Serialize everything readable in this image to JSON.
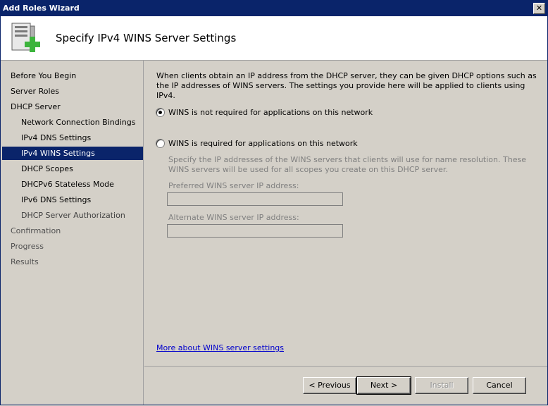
{
  "window": {
    "title": "Add Roles Wizard"
  },
  "header": {
    "page_title": "Specify IPv4 WINS Server Settings"
  },
  "sidebar": {
    "items": [
      {
        "label": "Before You Begin"
      },
      {
        "label": "Server Roles"
      },
      {
        "label": "DHCP Server"
      },
      {
        "label": "Network Connection Bindings"
      },
      {
        "label": "IPv4 DNS Settings"
      },
      {
        "label": "IPv4 WINS Settings"
      },
      {
        "label": "DHCP Scopes"
      },
      {
        "label": "DHCPv6 Stateless Mode"
      },
      {
        "label": "IPv6 DNS Settings"
      },
      {
        "label": "DHCP Server Authorization"
      },
      {
        "label": "Confirmation"
      },
      {
        "label": "Progress"
      },
      {
        "label": "Results"
      }
    ]
  },
  "main": {
    "intro": "When clients obtain an IP address from the DHCP server, they can be given DHCP options such as the IP addresses of WINS servers. The settings you provide here will be applied to clients using IPv4.",
    "option_not_required": "WINS is not required for applications on this network",
    "option_required": "WINS is required for applications on this network",
    "sub_description": "Specify the IP addresses of the WINS servers that clients will use for name resolution. These WINS servers will be used for all scopes you create on this DHCP server.",
    "preferred_label": "Preferred WINS server IP address:",
    "preferred_value": "",
    "alternate_label": "Alternate WINS server IP address:",
    "alternate_value": "",
    "more_link": "More about WINS server settings"
  },
  "footer": {
    "previous": "< Previous",
    "next": "Next >",
    "install": "Install",
    "cancel": "Cancel"
  }
}
